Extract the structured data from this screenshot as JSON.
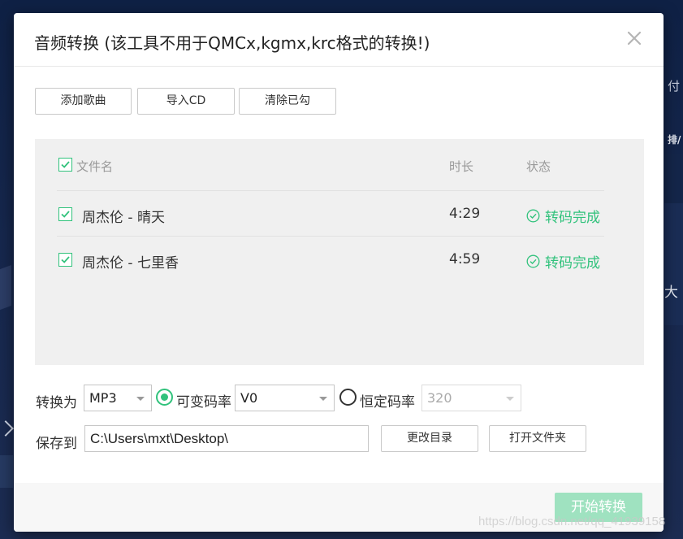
{
  "background": {
    "side_text_pay": "付",
    "side_text_rank": "排/",
    "side_text_big": "大"
  },
  "dialog": {
    "title": "音频转换 (该工具不用于QMCx,kgmx,krc格式的转换!)",
    "close_icon": "close-icon"
  },
  "toolbar": {
    "add_label": "添加歌曲",
    "cd_label": "导入CD",
    "clear_label": "清除已勾"
  },
  "list": {
    "headers": {
      "filename": "文件名",
      "duration": "时长",
      "status": "状态"
    },
    "header_checked": true,
    "rows": [
      {
        "checked": true,
        "name": "周杰伦 - 晴天",
        "duration": "4:29",
        "status": "转码完成"
      },
      {
        "checked": true,
        "name": "周杰伦 - 七里香",
        "duration": "4:59",
        "status": "转码完成"
      }
    ]
  },
  "settings": {
    "convert_label": "转换为",
    "format_value": "MP3",
    "vbr_label": "可变码率",
    "vbr_selected": true,
    "vbr_value": "V0",
    "cbr_label": "恒定码率",
    "cbr_selected": false,
    "cbr_value": "320",
    "save_label": "保存到",
    "save_path": "C:\\Users\\mxt\\Desktop\\",
    "change_dir_label": "更改目录",
    "open_folder_label": "打开文件夹"
  },
  "footer": {
    "start_label": "开始转换"
  },
  "watermark": "https://blog.csdn.net/qq_41939158",
  "colors": {
    "accent": "#31c27c",
    "start_disabled": "#9fe2c0"
  }
}
